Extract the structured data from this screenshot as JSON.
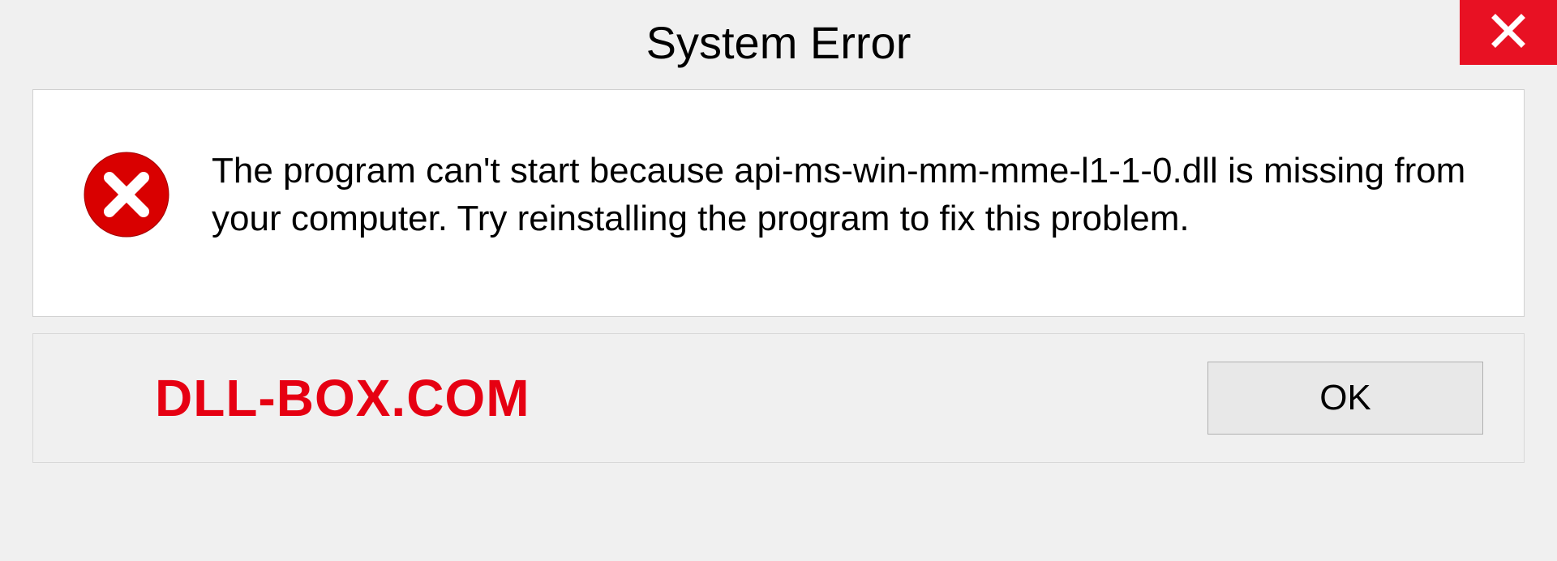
{
  "title": "System Error",
  "message": "The program can't start because api-ms-win-mm-mme-l1-1-0.dll is missing from your computer. Try reinstalling the program to fix this problem.",
  "watermark": "DLL-BOX.COM",
  "ok_label": "OK",
  "colors": {
    "close_bg": "#e81123",
    "error_icon": "#d90000",
    "watermark": "#e60012"
  }
}
